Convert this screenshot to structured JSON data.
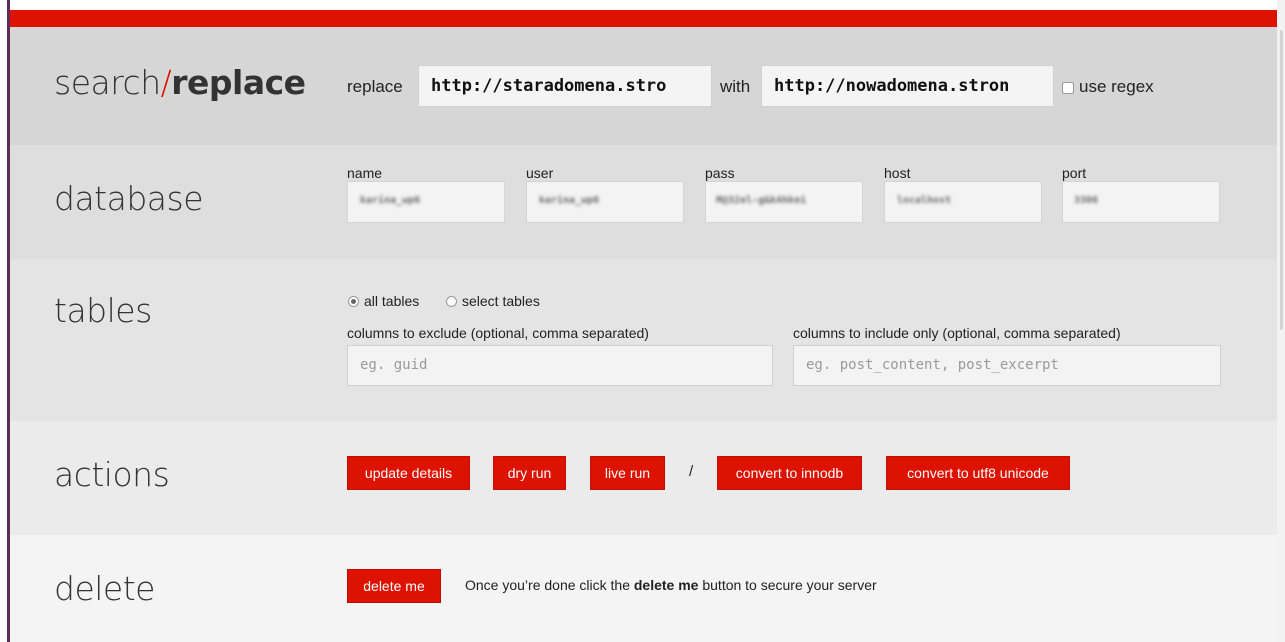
{
  "brand": {
    "accent": "#dd1200",
    "frame": "#5c2d5c"
  },
  "search_replace": {
    "heading_part1": "search",
    "heading_slash": "/",
    "heading_part2": "replace",
    "replace_label": "replace",
    "search_value": "http://staradomena.stro",
    "with_label": "with",
    "replace_value": "http://nowadomena.stron",
    "regex_label": "use regex"
  },
  "database": {
    "heading": "database",
    "fields": [
      {
        "label": "name",
        "value": "karina_wp6"
      },
      {
        "label": "user",
        "value": "karina_wp6"
      },
      {
        "label": "pass",
        "value": "M@32el-g&kAhkei"
      },
      {
        "label": "host",
        "value": "localhost"
      },
      {
        "label": "port",
        "value": "3306"
      }
    ]
  },
  "tables": {
    "heading": "tables",
    "radio_all": "all tables",
    "radio_select": "select tables",
    "exclude_label": "columns to exclude (optional, comma separated)",
    "exclude_placeholder": "eg. guid",
    "include_label": "columns to include only (optional, comma separated)",
    "include_placeholder": "eg. post_content, post_excerpt"
  },
  "actions": {
    "heading": "actions",
    "buttons": [
      "update details",
      "dry run",
      "live run",
      "convert to innodb",
      "convert to utf8 unicode"
    ],
    "separator": "/"
  },
  "delete": {
    "heading": "delete",
    "button": "delete me",
    "note_prefix": "Once you’re done click the ",
    "note_bold": "delete me",
    "note_suffix": " button to secure your server"
  }
}
